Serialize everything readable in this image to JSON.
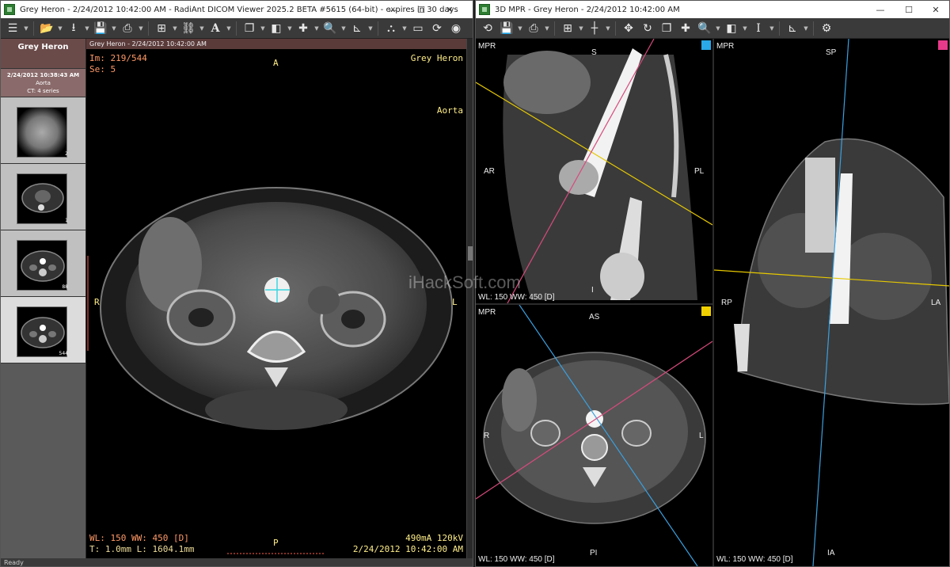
{
  "left_window": {
    "title": "Grey Heron - 2/24/2012 10:42:00 AM - RadiAnt DICOM Viewer 2025.2 BETA #5615 (64-bit) - expires in 30 days",
    "controls": {
      "minimize": "—",
      "maximize": "☐",
      "close": "✕"
    },
    "toolbar_icons": [
      "menu-icon",
      "open-folder-icon",
      "download-icon",
      "save-icon",
      "print-icon",
      "layout-icon",
      "link-icon",
      "text-annotation-icon",
      "series-stack-icon",
      "window-level-icon",
      "crosshair-add-icon",
      "zoom-icon",
      "measure-icon",
      "mpr-icon",
      "film-icon",
      "rotate-3d-icon",
      "3d-icon"
    ],
    "sidebar": {
      "patient_name": "Grey Heron",
      "study": {
        "date": "2/24/2012 10:38:43 AM",
        "description": "Aorta",
        "summary": "CT: 4 series"
      },
      "series": [
        {
          "count": "2",
          "selected": false
        },
        {
          "count": "1",
          "selected": false
        },
        {
          "count": "88",
          "selected": false
        },
        {
          "count": "544",
          "selected": true
        }
      ]
    },
    "viewport": {
      "header": "Grey Heron - 2/24/2012 10:42:00 AM",
      "image_index": "Im: 219/544",
      "series_no": "Se: 5",
      "patient": "Grey Heron",
      "description": "Aorta",
      "orient_top": "A",
      "orient_bottom": "P",
      "orient_left": "R",
      "orient_right": "L",
      "window": "WL: 150 WW: 450 [D]",
      "thickness": "T: 1.0mm L: 1604.1mm",
      "exposure": "490mA 120kV",
      "datetime": "2/24/2012 10:42:00 AM"
    },
    "status": "Ready"
  },
  "right_window": {
    "title": "3D MPR - Grey Heron - 2/24/2012 10:42:00 AM",
    "controls": {
      "minimize": "—",
      "maximize": "☐",
      "close": "✕"
    },
    "toolbar_icons": [
      "reset-icon",
      "save-icon",
      "print-icon",
      "layout-icon",
      "crosshair-icon",
      "pan-icon",
      "rotate-icon",
      "series-stack-icon",
      "crosshair-add-icon",
      "zoom-icon",
      "window-level-icon",
      "thickness-icon",
      "measure-icon",
      "settings-icon"
    ],
    "watermark": "iHackSoft.com",
    "panes": [
      {
        "name": "sagittal",
        "label": "MPR",
        "top": "S",
        "bottom": "I",
        "left": "AR",
        "right": "PL",
        "window": "WL: 150 WW: 450 [D]",
        "marker_color": "#2aa8e8"
      },
      {
        "name": "coronal",
        "label": "MPR",
        "top": "SP",
        "bottom": "IA",
        "left": "RP",
        "right": "LA",
        "window": "WL: 150 WW: 450 [D]",
        "marker_color": "#e83a8a"
      },
      {
        "name": "axial",
        "label": "MPR",
        "top": "AS",
        "bottom": "PI",
        "left": "R",
        "right": "L",
        "window": "WL: 150 WW: 450 [D]",
        "marker_color": "#f0d000"
      }
    ],
    "line_colors": {
      "yellow": "#e6c800",
      "pink": "#d84a7c",
      "blue": "#3aa0e0"
    }
  }
}
